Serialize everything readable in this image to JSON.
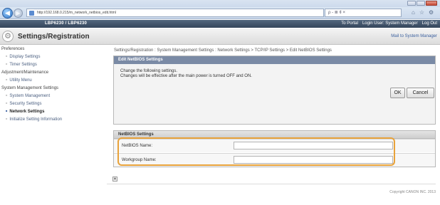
{
  "browser": {
    "url": "http://192.168.0.215/m_network_netbios_edit.html",
    "search_text": "ρ - ≣ ¢ ×"
  },
  "header": {
    "product_name": "LBP6230 / LBP6230",
    "links": [
      "To Portal",
      "Login User: System Manager",
      "Log Out"
    ]
  },
  "titlebar": {
    "title": "Settings/Registration",
    "mail_link": "Mail to System Manager"
  },
  "sidebar": {
    "items": [
      {
        "label": "Preferences",
        "type": "section"
      },
      {
        "label": "Display Settings",
        "type": "sub"
      },
      {
        "label": "Timer Settings",
        "type": "sub"
      },
      {
        "label": "Adjustment/Maintenance",
        "type": "section"
      },
      {
        "label": "Utility Menu",
        "type": "sub"
      },
      {
        "label": "System Management Settings",
        "type": "section"
      },
      {
        "label": "System Management",
        "type": "sub"
      },
      {
        "label": "Security Settings",
        "type": "sub"
      },
      {
        "label": "Network Settings",
        "type": "sub-active"
      },
      {
        "label": "Initialize Setting Information",
        "type": "sub"
      }
    ]
  },
  "main": {
    "breadcrumb": "Settings/Registration : System Management Settings : Network Settings > TCP/IP Settings > Edit NetBIOS Settings",
    "edit_panel": {
      "title": "Edit NetBIOS Settings",
      "msg_line1": "Change the following settings.",
      "msg_line2": "Changes will be effective after the main power is turned OFF and ON.",
      "ok_label": "OK",
      "cancel_label": "Cancel"
    },
    "netbios_panel": {
      "title": "NetBIOS Settings",
      "netbios_name_label": "NetBIOS Name:",
      "netbios_name_value": "",
      "workgroup_label": "Workgroup Name:",
      "workgroup_value": ""
    }
  },
  "footer": {
    "copyright": "Copyright CANON INC. 2013"
  },
  "colors": {
    "header_bg": "#3f5168",
    "panel_head_bg": "#7a8aa5",
    "highlight": "#e8a23a"
  }
}
